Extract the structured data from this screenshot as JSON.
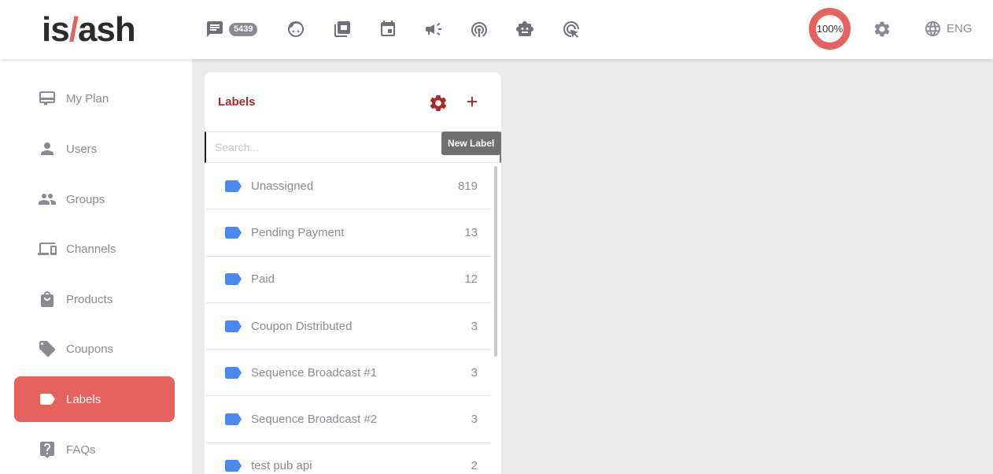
{
  "header": {
    "logo_left": "is",
    "logo_slash": "/",
    "logo_right": "ash",
    "chat_badge": "5439",
    "progress_label": "100%",
    "progress_value": 100,
    "language": "ENG",
    "nav_icons": [
      "chat-icon",
      "face-icon",
      "channels-icon",
      "calendar-icon",
      "broadcast-icon",
      "podcast-icon",
      "bot-icon",
      "cursor-icon"
    ]
  },
  "sidebar": {
    "items": [
      {
        "label": "My Plan",
        "icon": "plan-icon"
      },
      {
        "label": "Users",
        "icon": "user-icon"
      },
      {
        "label": "Groups",
        "icon": "group-icon"
      },
      {
        "label": "Channels",
        "icon": "devices-icon"
      },
      {
        "label": "Products",
        "icon": "bag-icon"
      },
      {
        "label": "Coupons",
        "icon": "tags-icon"
      },
      {
        "label": "Labels",
        "icon": "label-icon",
        "active": true
      },
      {
        "label": "FAQs",
        "icon": "question-icon"
      }
    ]
  },
  "labels_panel": {
    "title": "Labels",
    "search_placeholder": "Search...",
    "tooltip": "New Label",
    "rows": [
      {
        "name": "Unassigned",
        "count": "819"
      },
      {
        "name": "Pending Payment",
        "count": "13"
      },
      {
        "name": "Paid",
        "count": "12"
      },
      {
        "name": "Coupon Distributed",
        "count": "3"
      },
      {
        "name": "Sequence Broadcast #1",
        "count": "3"
      },
      {
        "name": "Sequence Broadcast #2",
        "count": "3"
      },
      {
        "name": "test pub api",
        "count": "2"
      }
    ]
  },
  "colors": {
    "accent": "#e5625e",
    "panel_title": "#a52a2a",
    "label_tag": "#4c86f0",
    "muted": "#8a8a92"
  }
}
